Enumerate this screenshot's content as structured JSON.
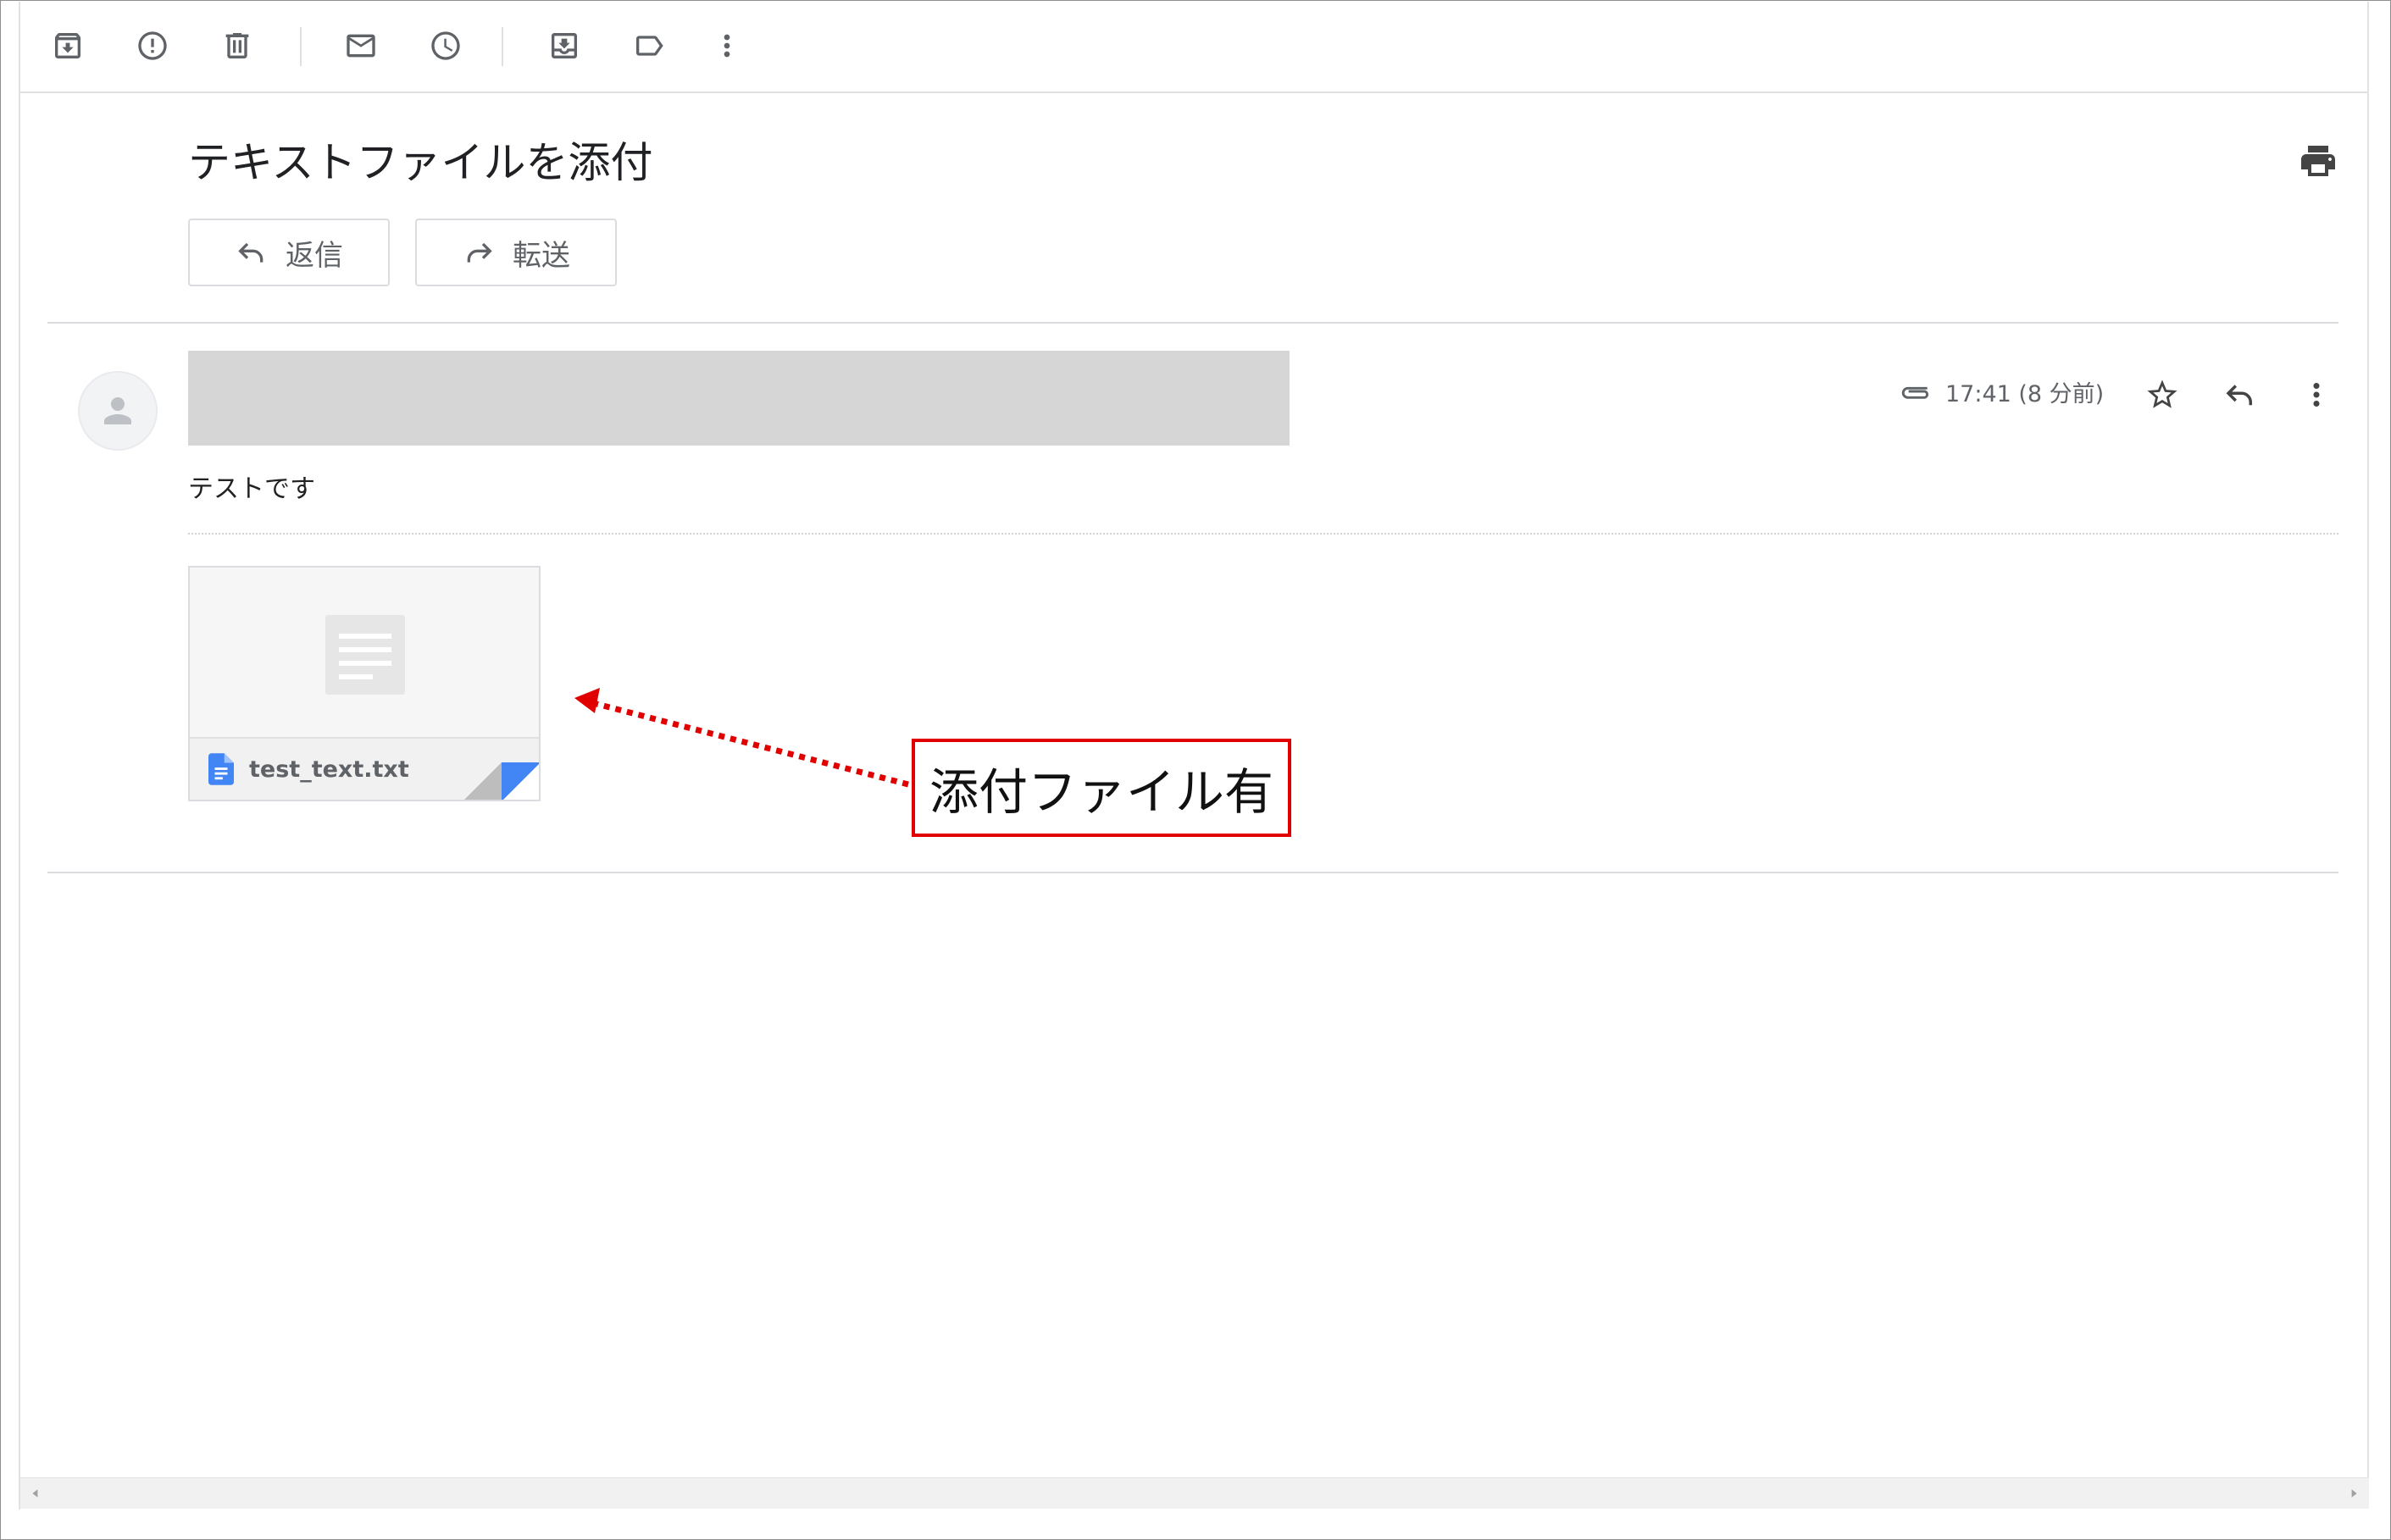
{
  "toolbar": {
    "icons": [
      "archive-icon",
      "report-spam-icon",
      "delete-icon",
      "mark-unread-icon",
      "snooze-icon",
      "move-to-icon",
      "label-icon",
      "more-vert-icon"
    ]
  },
  "email": {
    "subject": "テキストファイルを添付",
    "reply_label": "返信",
    "forward_label": "転送",
    "time": "17:41 (8 分前)",
    "body": "テストです",
    "attachment": {
      "filename": "test_text.txt",
      "type_icon": "docs-file-icon"
    }
  },
  "annotation": {
    "label": "添付ファイル有"
  },
  "colors": {
    "accent_blue": "#4285f4",
    "annotation_red": "#e00000",
    "icon_gray": "#5f6368",
    "redaction_gray": "#d6d6d6"
  }
}
